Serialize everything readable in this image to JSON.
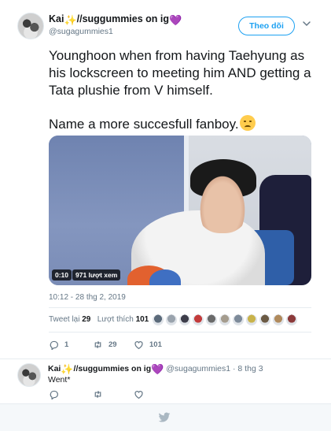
{
  "tweet": {
    "display_name": "Kai",
    "name_suffix": "//suggummies on ig",
    "handle": "@sugagummies1",
    "follow_label": "Theo dõi",
    "text_main": "Younghoon when from having Taehyung as his lockscreen to meeting him AND getting a Tata plushie from V himself.",
    "text_second": "Name a more succesfull fanboy.",
    "media": {
      "duration": "0:10",
      "views": "971 lượt xem"
    },
    "timestamp": "10:12 - 28 thg 2, 2019",
    "stats": {
      "retweets_label": "Tweet lại",
      "retweets_count": "29",
      "likes_label": "Lượt thích",
      "likes_count": "101"
    },
    "actions": {
      "reply_count": "1",
      "retweet_count": "29",
      "like_count": "101"
    },
    "liker_colors": [
      "#5b6a7a",
      "#9aa3ad",
      "#3d3d4a",
      "#c33b3b",
      "#6a6a6a",
      "#a59c8e",
      "#7d8a99",
      "#c9b34a",
      "#6b5a44",
      "#b08a5c",
      "#8c3a3a"
    ]
  },
  "reply": {
    "display_name": "Kai",
    "name_suffix": "//suggummies on ig",
    "meta": "@sugagummies1 · 8 thg 3",
    "text": "Went*"
  },
  "icons": {
    "sparkle": "✨",
    "heart": "💜",
    "emoji": "disappointed-relieved-face"
  },
  "colors": {
    "accent": "#1da1f2",
    "muted": "#657786",
    "text": "#14171a"
  }
}
